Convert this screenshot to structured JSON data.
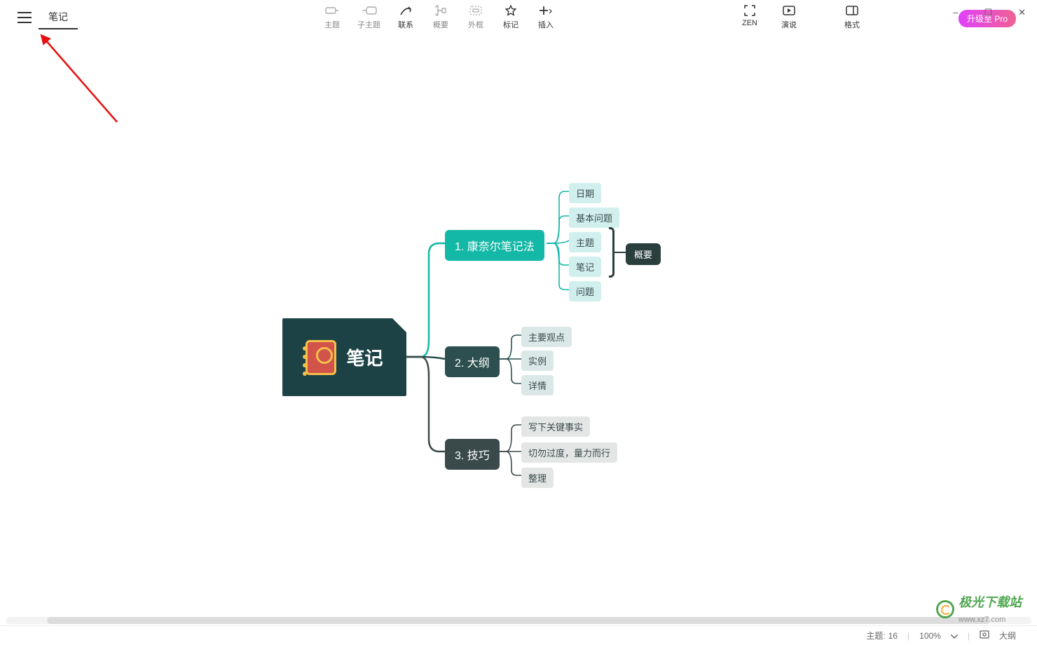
{
  "window": {
    "min": "–",
    "max": "☐",
    "close": "✕"
  },
  "tabs": {
    "main": "笔记"
  },
  "toolbar": {
    "topic": "主题",
    "subtopic": "子主题",
    "relation": "联系",
    "summary": "概要",
    "boundary": "外框",
    "marker": "标记",
    "insert": "插入",
    "zen": "ZEN",
    "present": "演说",
    "format": "格式",
    "upgrade": "升级至 Pro"
  },
  "mindmap": {
    "root": "笔记",
    "branch1": {
      "label": "1. 康奈尔笔记法",
      "leaves": [
        "日期",
        "基本问题",
        "主题",
        "笔记",
        "问题"
      ],
      "summary": "概要"
    },
    "branch2": {
      "label": "2. 大纲",
      "leaves": [
        "主要观点",
        "实例",
        "详情"
      ]
    },
    "branch3": {
      "label": "3. 技巧",
      "leaves": [
        "写下关键事实",
        "切勿过度，量力而行",
        "整理"
      ]
    }
  },
  "status": {
    "topics_label": "主题:",
    "topics_count": "16",
    "zoom": "100%",
    "outline": "大纲"
  },
  "watermark": {
    "text": "极光下载站",
    "url": "www.xz7.com"
  }
}
